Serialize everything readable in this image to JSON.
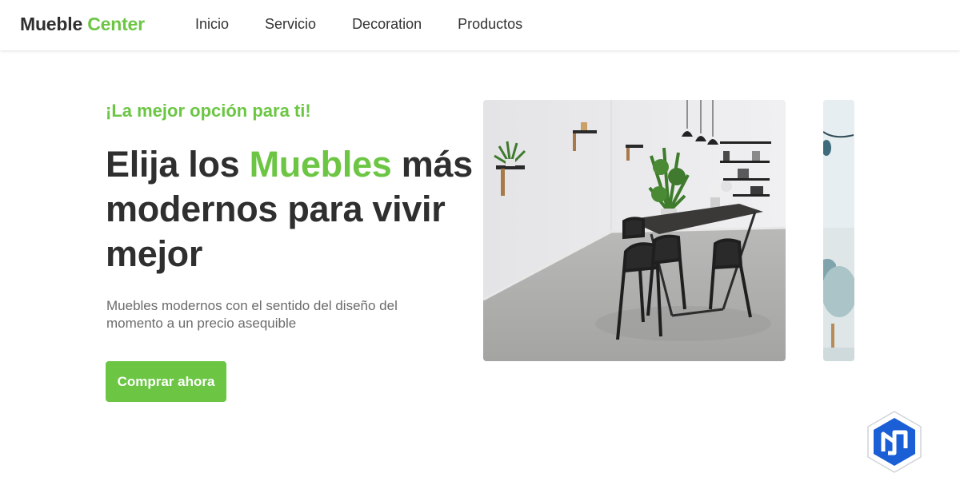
{
  "brand": {
    "name_part1": "Mueble ",
    "name_part2": "Center"
  },
  "nav": {
    "items": [
      "Inicio",
      "Servicio",
      "Decoration",
      "Productos"
    ]
  },
  "hero": {
    "tagline": "¡La mejor opción para ti!",
    "headline_part1": "Elija los ",
    "headline_accent": "Muebles",
    "headline_part2": " más modernos para vivir mejor",
    "description": "Muebles modernos con el sentido del diseño del momento a un precio asequible",
    "cta_label": "Comprar ahora"
  },
  "images": {
    "main": "dining-room-photo",
    "side": "living-room-photo-partial"
  },
  "badge": {
    "icon": "hexagon-logo-icon"
  },
  "colors": {
    "accent": "#6cc644",
    "text": "#2f2f2f",
    "muted": "#6b6b6b",
    "badge_blue": "#1a5fd6"
  }
}
